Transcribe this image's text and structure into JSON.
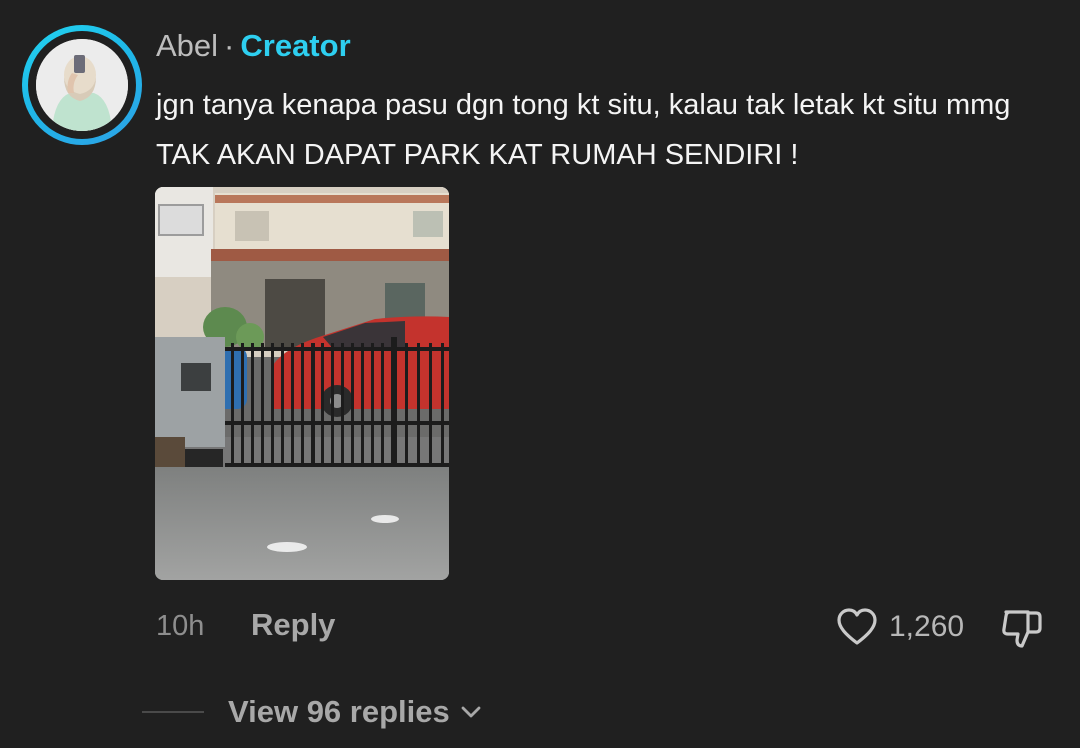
{
  "comment": {
    "author": {
      "name": "Abel",
      "separator": "·",
      "badge": "Creator"
    },
    "text": "jgn tanya kenapa pasu dgn tong kt situ, kalau tak letak kt situ mmg TAK AKAN DAPAT PARK KAT RUMAH SENDIRI !",
    "timestamp": "10h",
    "reply_label": "Reply",
    "likes": "1,260",
    "view_replies_label": "View 96 replies"
  },
  "icons": {
    "like": "heart-outline-icon",
    "dislike": "thumbs-down-icon",
    "expand": "chevron-down-icon"
  },
  "colors": {
    "background": "#202020",
    "accent": "#2ecff0",
    "avatar_ring": "#22d4f0",
    "muted_text": "#a8a8a8"
  }
}
